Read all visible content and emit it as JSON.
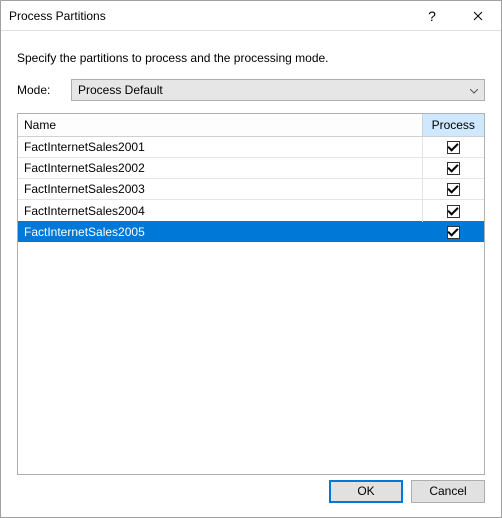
{
  "titlebar": {
    "title": "Process Partitions"
  },
  "instruction": "Specify the partitions to process and the processing mode.",
  "mode": {
    "label": "Mode:",
    "value": "Process Default"
  },
  "table": {
    "headers": {
      "name": "Name",
      "process": "Process"
    },
    "rows": [
      {
        "name": "FactInternetSales2001",
        "checked": true,
        "selected": false
      },
      {
        "name": "FactInternetSales2002",
        "checked": true,
        "selected": false
      },
      {
        "name": "FactInternetSales2003",
        "checked": true,
        "selected": false
      },
      {
        "name": "FactInternetSales2004",
        "checked": true,
        "selected": false
      },
      {
        "name": "FactInternetSales2005",
        "checked": true,
        "selected": true
      }
    ]
  },
  "footer": {
    "ok": "OK",
    "cancel": "Cancel"
  }
}
